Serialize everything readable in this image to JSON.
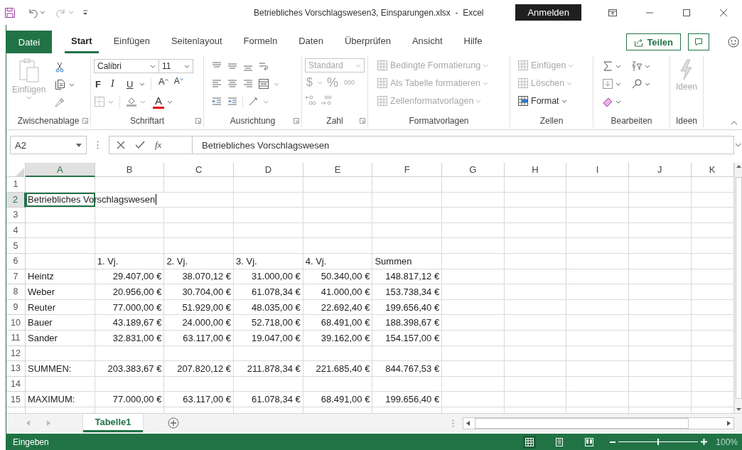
{
  "title_bar": {
    "title": "Betriebliches Vorschlagswesen3, Einsparungen.xlsx  -  Excel",
    "sign_in": "Anmelden"
  },
  "file_tab": "Datei",
  "tabs": [
    {
      "label": "Start",
      "selected": true
    },
    {
      "label": "Einfügen",
      "selected": false
    },
    {
      "label": "Seitenlayout",
      "selected": false
    },
    {
      "label": "Formeln",
      "selected": false
    },
    {
      "label": "Daten",
      "selected": false
    },
    {
      "label": "Überprüfen",
      "selected": false
    },
    {
      "label": "Ansicht",
      "selected": false
    },
    {
      "label": "Hilfe",
      "selected": false
    }
  ],
  "share_button": "Teilen",
  "ribbon": [
    {
      "kind": "clipboard",
      "label": "Zwischenablage",
      "paste": {
        "label": "Einfügen",
        "disabled": true
      }
    },
    {
      "kind": "font",
      "label": "Schriftart",
      "font_name": "Calibri",
      "font_size": "11",
      "bold": "F",
      "italic": "I",
      "underline": "U",
      "grow": "A",
      "shrink": "A",
      "font_color": "A"
    },
    {
      "kind": "alignment",
      "label": "Ausrichtung"
    },
    {
      "kind": "number",
      "label": "Zahl",
      "format": {
        "label": "Standard",
        "disabled": true
      },
      "currency": "$",
      "percent": "%",
      "thousands": "000"
    },
    {
      "kind": "styles",
      "label": "Formatvorlagen",
      "items": [
        {
          "label": "Bedingte Formatierung",
          "disabled": true
        },
        {
          "label": "Als Tabelle formatieren",
          "disabled": true
        },
        {
          "label": "Zellenformatvorlagen",
          "disabled": true
        }
      ]
    },
    {
      "kind": "cells",
      "label": "Zellen",
      "items": [
        {
          "label": "Einfügen",
          "disabled": true
        },
        {
          "label": "Löschen",
          "disabled": true
        },
        {
          "label": "Format",
          "disabled": false
        }
      ]
    },
    {
      "kind": "editing",
      "label": "Bearbeiten"
    },
    {
      "kind": "ideas",
      "label": "Ideen",
      "button": {
        "label": "Ideen",
        "disabled": true
      }
    }
  ],
  "formula_bar": {
    "name_box": "A2",
    "function_label": "fx",
    "formula": "Betriebliches Vorschlagswesen"
  },
  "grid": {
    "edit_mode": true,
    "columns": [
      {
        "label": "A",
        "selected": true
      },
      {
        "label": "B",
        "selected": false
      },
      {
        "label": "C",
        "selected": false
      },
      {
        "label": "D",
        "selected": false
      },
      {
        "label": "E",
        "selected": false
      },
      {
        "label": "F",
        "selected": false
      },
      {
        "label": "G",
        "selected": false
      },
      {
        "label": "H",
        "selected": false
      },
      {
        "label": "I",
        "selected": false
      },
      {
        "label": "J",
        "selected": false
      },
      {
        "label": "K",
        "selected": false
      }
    ],
    "rows": [
      {
        "number": "1",
        "selected": false
      },
      {
        "number": "2",
        "selected": true,
        "kind": "title",
        "cells": [
          "Betriebliches Vorschlagswesen"
        ]
      },
      {
        "number": "3",
        "selected": false
      },
      {
        "number": "4",
        "selected": false
      },
      {
        "number": "5",
        "selected": false
      },
      {
        "number": "6",
        "selected": false,
        "kind": "header",
        "cells": [
          null,
          "1. Vj.",
          "2. Vj.",
          "3. Vj.",
          "4. Vj.",
          "Summen"
        ]
      },
      {
        "number": "7",
        "selected": false,
        "kind": "data",
        "cells": [
          "Heintz",
          "29.407,00 €",
          "38.070,12 €",
          "31.000,00 €",
          "50.340,00 €",
          "148.817,12 €"
        ]
      },
      {
        "number": "8",
        "selected": false,
        "kind": "data",
        "cells": [
          "Weber",
          "20.956,00 €",
          "30.704,00 €",
          "61.078,34 €",
          "41.000,00 €",
          "153.738,34 €"
        ]
      },
      {
        "number": "9",
        "selected": false,
        "kind": "data",
        "cells": [
          "Reuter",
          "77.000,00 €",
          "51.929,00 €",
          "48.035,00 €",
          "22.692,40 €",
          "199.656,40 €"
        ]
      },
      {
        "number": "10",
        "selected": false,
        "kind": "data",
        "cells": [
          "Bauer",
          "43.189,67 €",
          "24.000,00 €",
          "52.718,00 €",
          "68.491,00 €",
          "188.398,67 €"
        ]
      },
      {
        "number": "11",
        "selected": false,
        "kind": "data",
        "cells": [
          "Sander",
          "32.831,00 €",
          "63.117,00 €",
          "19.047,00 €",
          "39.162,00 €",
          "154.157,00 €"
        ]
      },
      {
        "number": "12",
        "selected": false
      },
      {
        "number": "13",
        "selected": false,
        "kind": "data",
        "cells": [
          "SUMMEN:",
          "203.383,67 €",
          "207.820,12 €",
          "211.878,34 €",
          "221.685,40 €",
          "844.767,53 €"
        ]
      },
      {
        "number": "14",
        "selected": false
      },
      {
        "number": "15",
        "selected": false,
        "kind": "data",
        "cells": [
          "MAXIMUM:",
          "77.000,00 €",
          "63.117,00 €",
          "61.078,34 €",
          "68.491,00 €",
          "199.656,40 €"
        ]
      }
    ]
  },
  "sheets": [
    {
      "label": "Tabelle1",
      "selected": true
    }
  ],
  "status_bar": {
    "mode": "Eingeben",
    "views": [
      {
        "kind": "normal",
        "selected": true
      },
      {
        "kind": "page_layout",
        "selected": false
      },
      {
        "kind": "page_break",
        "selected": false
      }
    ],
    "zoom": {
      "level": 0.5,
      "label": "100%"
    }
  }
}
